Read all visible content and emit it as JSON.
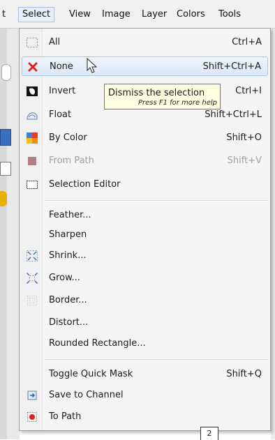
{
  "menubar": {
    "items": [
      {
        "label": "t"
      },
      {
        "label": "Select"
      },
      {
        "label": "View"
      },
      {
        "label": "Image"
      },
      {
        "label": "Layer"
      },
      {
        "label": "Colors"
      },
      {
        "label": "Tools"
      }
    ]
  },
  "menu": {
    "items": [
      {
        "label": "All",
        "shortcut": "Ctrl+A",
        "icon": "select-all-icon"
      },
      {
        "label": "None",
        "shortcut": "Shift+Ctrl+A",
        "icon": "select-none-icon"
      },
      {
        "label": "Invert",
        "shortcut": "Ctrl+I",
        "icon": "invert-selection-icon"
      },
      {
        "label": "Float",
        "shortcut": "Shift+Ctrl+L",
        "icon": "float-selection-icon"
      },
      {
        "label": "By Color",
        "shortcut": "Shift+O",
        "icon": "select-by-color-icon"
      },
      {
        "label": "From Path",
        "shortcut": "Shift+V",
        "icon": "selection-from-path-icon",
        "disabled": true
      },
      {
        "label": "Selection Editor",
        "shortcut": "",
        "icon": "selection-editor-icon"
      },
      {
        "label": "Feather...",
        "shortcut": ""
      },
      {
        "label": "Sharpen",
        "shortcut": ""
      },
      {
        "label": "Shrink...",
        "shortcut": "",
        "icon": "shrink-icon"
      },
      {
        "label": "Grow...",
        "shortcut": "",
        "icon": "grow-icon"
      },
      {
        "label": "Border...",
        "shortcut": "",
        "icon": "border-icon"
      },
      {
        "label": "Distort...",
        "shortcut": ""
      },
      {
        "label": "Rounded Rectangle...",
        "shortcut": ""
      },
      {
        "label": "Toggle Quick Mask",
        "shortcut": "Shift+Q"
      },
      {
        "label": "Save to Channel",
        "shortcut": "",
        "icon": "save-to-channel-icon"
      },
      {
        "label": "To Path",
        "shortcut": "",
        "icon": "to-path-icon"
      }
    ]
  },
  "tooltip": {
    "title": "Dismiss the selection",
    "help": "Press F1 for more help"
  },
  "canvas": {
    "tab_number": "2"
  },
  "colors": {
    "accent": "#a8c5ec",
    "tooltip_bg": "#ffffe1",
    "close_red": "#e02020"
  }
}
